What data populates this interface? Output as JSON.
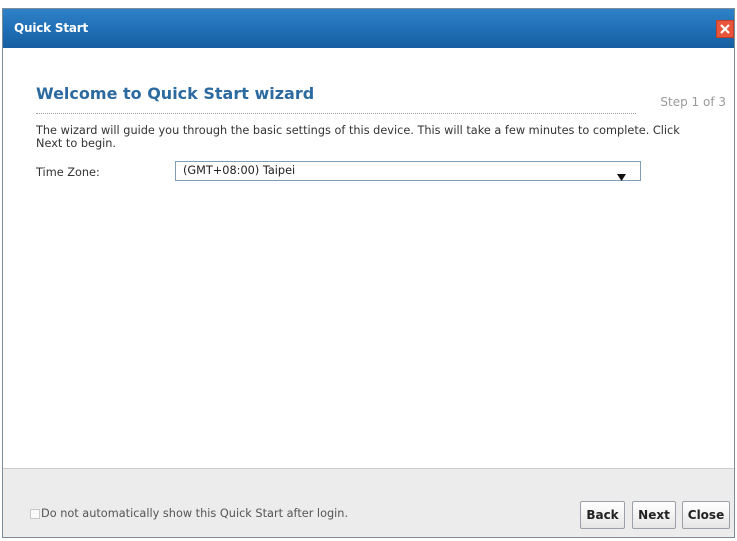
{
  "window": {
    "title": "Quick Start"
  },
  "main": {
    "heading": "Welcome to Quick Start wizard",
    "step": "Step 1 of 3",
    "description": "The wizard will guide you through the basic settings of this device. This will take a few minutes to complete. Click Next to begin.",
    "timezone": {
      "label": "Time Zone:",
      "value": "(GMT+08:00) Taipei"
    }
  },
  "footer": {
    "checkbox_label": "Do not automatically show this Quick Start after login.",
    "checkbox_checked": false,
    "back_label": "Back",
    "next_label": "Next",
    "close_label": "Close"
  },
  "colors": {
    "titlebar": "#1f6eb5",
    "heading": "#2c6aa0",
    "close_button": "#e8553a"
  }
}
